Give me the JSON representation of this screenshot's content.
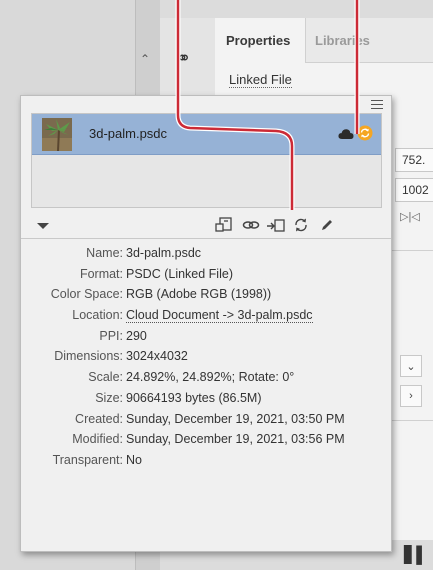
{
  "tabs": [
    {
      "label": "Properties",
      "active": true
    },
    {
      "label": "Libraries",
      "active": false
    }
  ],
  "properties": {
    "section_label": "Linked File",
    "fields": [
      "752.",
      "1002"
    ]
  },
  "panel": {
    "link_item": {
      "name": "3d-palm.psdc",
      "selected": true
    },
    "toolbar_icons": [
      "replace-link-icon",
      "go-to-link-icon",
      "embed-icon",
      "update-link-icon",
      "edit-original-icon"
    ],
    "info": [
      {
        "label": "Name:",
        "value": "3d-palm.psdc"
      },
      {
        "label": "Format:",
        "value": "PSDC (Linked File)"
      },
      {
        "label": "Color Space:",
        "value": "RGB (Adobe RGB (1998))"
      },
      {
        "label": "Location:",
        "value": "Cloud Document -> 3d-palm.psdc",
        "is_link": true
      },
      {
        "label": "PPI:",
        "value": "290"
      },
      {
        "label": "Dimensions:",
        "value": "3024x4032"
      },
      {
        "label": "Scale:",
        "value": "24.892%, 24.892%; Rotate: 0°"
      },
      {
        "label": "Size:",
        "value": "90664193 bytes (86.5M)"
      },
      {
        "label": "Created:",
        "value": "Sunday, December 19, 2021, 03:50 PM"
      },
      {
        "label": "Modified:",
        "value": "Sunday, December 19, 2021, 03:56 PM"
      },
      {
        "label": "Transparent:",
        "value": "No"
      }
    ]
  },
  "colors": {
    "selection": "#96b2d6",
    "callout_red": "#cc2a36",
    "sync_orange": "#f5a623"
  }
}
